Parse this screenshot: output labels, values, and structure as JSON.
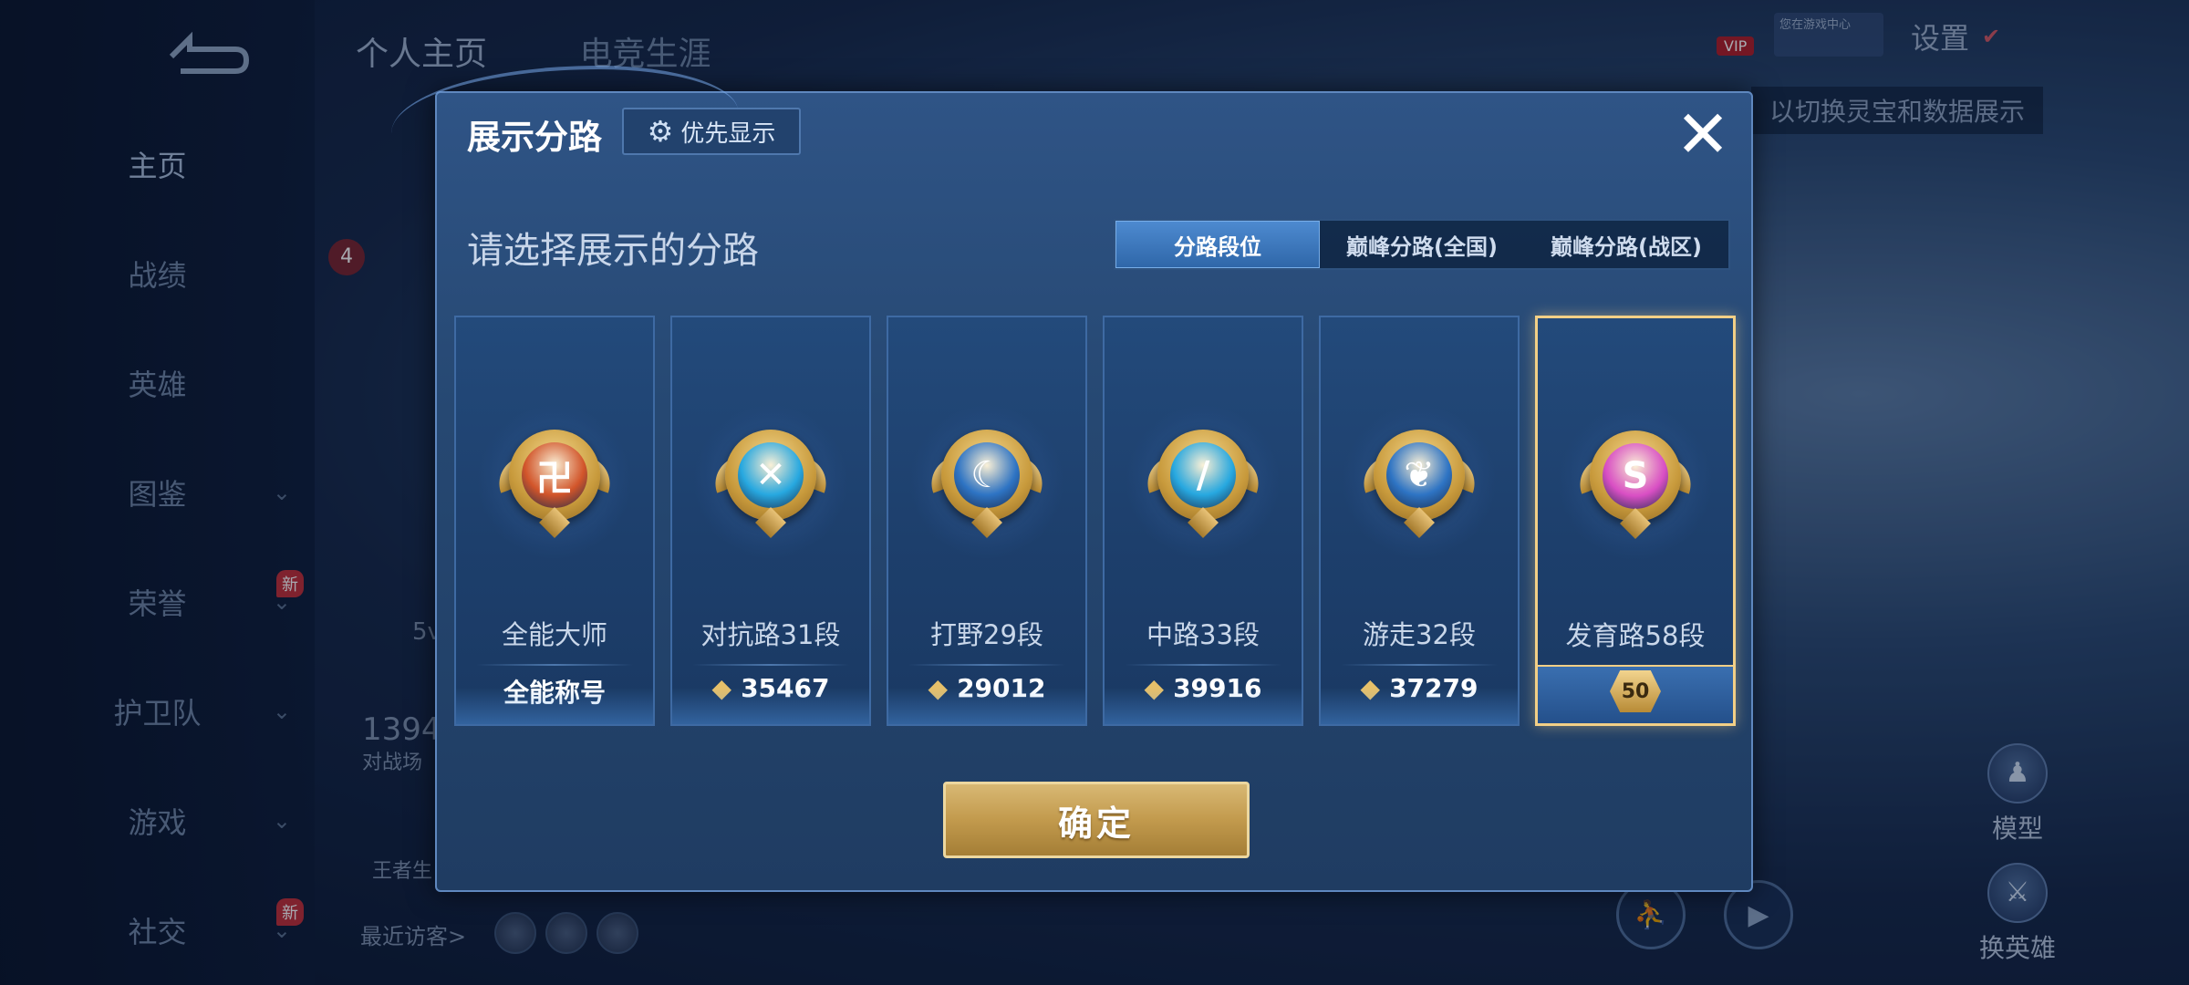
{
  "background": {
    "nav": [
      {
        "label": "主页",
        "active": true,
        "chevron": false,
        "new": false
      },
      {
        "label": "战绩",
        "active": false,
        "chevron": false,
        "new": false
      },
      {
        "label": "英雄",
        "active": false,
        "chevron": false,
        "new": false
      },
      {
        "label": "图鉴",
        "active": false,
        "chevron": true,
        "new": false
      },
      {
        "label": "荣誉",
        "active": false,
        "chevron": true,
        "new": true
      },
      {
        "label": "护卫队",
        "active": false,
        "chevron": true,
        "new": false
      },
      {
        "label": "游戏",
        "active": false,
        "chevron": true,
        "new": false
      },
      {
        "label": "社交",
        "active": false,
        "chevron": true,
        "new": true
      }
    ],
    "new_badge": "新",
    "top_tabs": [
      "个人主页",
      "电竞生涯"
    ],
    "settings_label": "设置",
    "vip_label": "VIP",
    "game_center_label": "您在游戏中心",
    "tip_text": "以切换灵宝和数据展示",
    "level_badge": "4",
    "count_text": "1394",
    "battle_text": "对战场",
    "wang_text": "王者生",
    "partial_text": "5v",
    "recent_visitors": "最近访客>",
    "model_label": "模型",
    "change_hero_label": "换英雄"
  },
  "dialog": {
    "title": "展示分路",
    "priority_label": "优先显示",
    "close_symbol": "✕",
    "subtitle": "请选择展示的分路",
    "tabs": [
      {
        "label": "分路段位",
        "active": true
      },
      {
        "label": "巅峰分路(全国)",
        "active": false
      },
      {
        "label": "巅峰分路(战区)",
        "active": false
      }
    ],
    "cards": [
      {
        "name": "全能大师",
        "value": "全能称号",
        "has_score_icon": false,
        "emblem": "all-round-emblem",
        "color": "#d2552a",
        "glyph": "卍",
        "selected": false
      },
      {
        "name": "对抗路31段",
        "value": "35467",
        "has_score_icon": true,
        "emblem": "clash-lane-emblem",
        "color": "#27a8e0",
        "glyph": "✕",
        "selected": false
      },
      {
        "name": "打野29段",
        "value": "29012",
        "has_score_icon": true,
        "emblem": "jungle-emblem",
        "color": "#2e74c4",
        "glyph": "☾",
        "selected": false
      },
      {
        "name": "中路33段",
        "value": "39916",
        "has_score_icon": true,
        "emblem": "mid-lane-emblem",
        "color": "#27a8e0",
        "glyph": "∕",
        "selected": false
      },
      {
        "name": "游走32段",
        "value": "37279",
        "has_score_icon": true,
        "emblem": "roam-emblem",
        "color": "#2e74c4",
        "glyph": "❦",
        "selected": false
      },
      {
        "name": "发育路58段",
        "value": "",
        "has_score_icon": false,
        "emblem": "farm-lane-emblem",
        "color": "#d94fc4",
        "glyph": "S",
        "selected": true,
        "level": "50"
      }
    ],
    "score_icon": "◆",
    "confirm_label": "确定"
  }
}
